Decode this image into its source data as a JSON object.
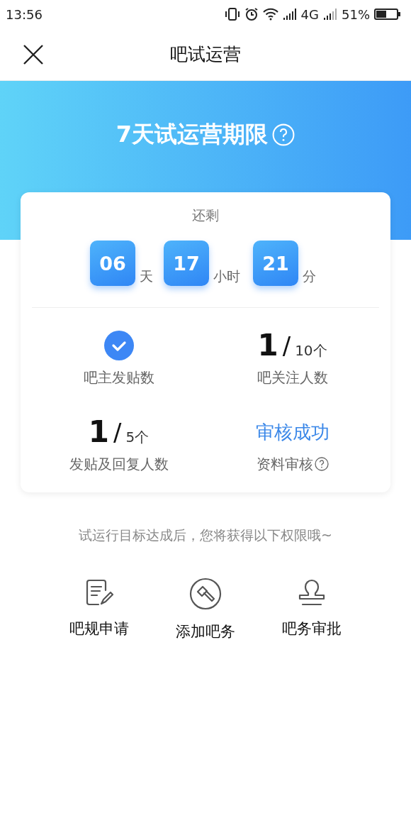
{
  "status_bar": {
    "time": "13:56",
    "network": "4G",
    "battery": "51%"
  },
  "nav": {
    "title": "吧试运营"
  },
  "banner": {
    "title": "7天试运营期限"
  },
  "countdown": {
    "label": "还剩",
    "units": [
      {
        "value": "06",
        "unit": "天"
      },
      {
        "value": "17",
        "unit": "小时"
      },
      {
        "value": "21",
        "unit": "分"
      }
    ]
  },
  "goal_rows": [
    {
      "goals": [
        {
          "kind": "check",
          "checked": true,
          "label": "吧主发贴数"
        },
        {
          "kind": "count",
          "value": "1",
          "separator": "/",
          "target": "10个",
          "label": "吧关注人数"
        }
      ]
    },
    {
      "goals": [
        {
          "kind": "count",
          "value": "1",
          "separator": "/",
          "target": "5个",
          "label": "发贴及回复人数"
        },
        {
          "kind": "status",
          "status": "审核成功",
          "label": "资料审核"
        }
      ]
    }
  ],
  "hint": "试运行目标达成后，您将获得以下权限哦~",
  "perks": [
    {
      "kind": "document",
      "label": "吧规申请"
    },
    {
      "kind": "gavel",
      "label": "添加吧务"
    },
    {
      "kind": "stamp",
      "label": "吧务审批"
    }
  ]
}
